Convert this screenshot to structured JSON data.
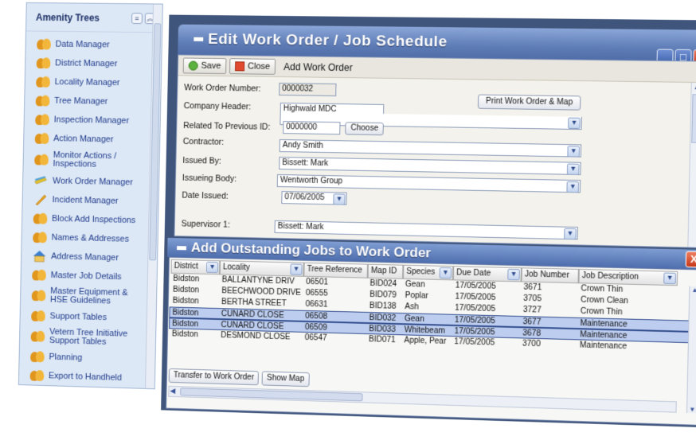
{
  "sidebar": {
    "title": "Amenity Trees",
    "items": [
      {
        "label": "Data Manager",
        "icon": "people-icon"
      },
      {
        "label": "District Manager",
        "icon": "people-icon"
      },
      {
        "label": "Locality Manager",
        "icon": "people-icon"
      },
      {
        "label": "Tree Manager",
        "icon": "people-icon"
      },
      {
        "label": "Inspection Manager",
        "icon": "people-icon"
      },
      {
        "label": "Action Manager",
        "icon": "people-icon"
      },
      {
        "label": "Monitor Actions / Inspections",
        "icon": "people-icon"
      },
      {
        "label": "Work Order Manager",
        "icon": "pencils-icon"
      },
      {
        "label": "Incident Manager",
        "icon": "pen-icon"
      },
      {
        "label": "Block Add Inspections",
        "icon": "people-icon"
      },
      {
        "label": "Names & Addresses",
        "icon": "people-icon"
      },
      {
        "label": "Address Manager",
        "icon": "house-icon"
      },
      {
        "label": "Master Job Details",
        "icon": "people-icon"
      },
      {
        "label": "Master Equipment & HSE Guidelines",
        "icon": "people-icon"
      },
      {
        "label": "Support Tables",
        "icon": "people-icon"
      },
      {
        "label": "Vetern Tree Initiative Support Tables",
        "icon": "people-icon"
      },
      {
        "label": "Planning",
        "icon": "people-icon"
      },
      {
        "label": "Export to Handheld",
        "icon": "people-icon"
      }
    ]
  },
  "window": {
    "title": "Edit Work Order / Job Schedule",
    "buttons": {
      "minimize": "_",
      "maximize": "□",
      "close": "X"
    }
  },
  "toolbar": {
    "save_label": "Save",
    "close_label": "Close",
    "form_title": "Add Work Order"
  },
  "form": {
    "work_order_number": {
      "label": "Work Order Number:",
      "value": "0000032"
    },
    "print_button": "Print Work Order & Map",
    "company_header": {
      "label": "Company Header:",
      "value": "Highwald MDC"
    },
    "related_id": {
      "label": "Related To Previous ID:",
      "value": "0000000",
      "button": "Choose"
    },
    "contractor": {
      "label": "Contractor:",
      "value": "Andy Smith"
    },
    "issued_by": {
      "label": "Issued By:",
      "value": "Bissett: Mark"
    },
    "issuing_body": {
      "label": "Issueing Body:",
      "value": "Wentworth Group"
    },
    "date_issued": {
      "label": "Date Issued:",
      "value": "07/06/2005"
    },
    "supervisor": {
      "label": "Supervisor 1:",
      "value": "Bissett: Mark"
    }
  },
  "jobs": {
    "title": "Add Outstanding Jobs to Work Order",
    "close": "X",
    "columns": [
      "District",
      "Locality",
      "Tree Reference",
      "Map ID",
      "Species",
      "Due Date",
      "Job Number",
      "Job Description"
    ],
    "rows": [
      [
        "Bidston",
        "BALLANTYNE DRIV",
        "06501",
        "BID024",
        "Gean",
        "17/05/2005",
        "3671",
        "Crown Thin"
      ],
      [
        "Bidston",
        "BEECHWOOD DRIVE",
        "06555",
        "BID079",
        "Poplar",
        "17/05/2005",
        "3705",
        "Crown Clean"
      ],
      [
        "Bidston",
        "BERTHA STREET",
        "06631",
        "BID138",
        "Ash",
        "17/05/2005",
        "3727",
        "Crown Thin"
      ],
      [
        "Bidston",
        "CUNARD CLOSE",
        "06508",
        "BID032",
        "Gean",
        "17/05/2005",
        "3677",
        "Maintenance"
      ],
      [
        "Bidston",
        "CUNARD CLOSE",
        "06509",
        "BID033",
        "Whitebeam",
        "17/05/2005",
        "3678",
        "Maintenance"
      ],
      [
        "Bidston",
        "DESMOND CLOSE",
        "06547",
        "BID071",
        "Apple, Pear",
        "17/05/2005",
        "3700",
        "Maintenance"
      ]
    ],
    "selected_rows": [
      3,
      4
    ],
    "transfer_button": "Transfer to Work Order",
    "show_map_button": "Show Map"
  },
  "colors": {
    "title_bar": "#5d7bb5",
    "desktop": "#40557b",
    "sidebar_bg": "#dde8f6",
    "selected_row": "#bccdf0"
  }
}
